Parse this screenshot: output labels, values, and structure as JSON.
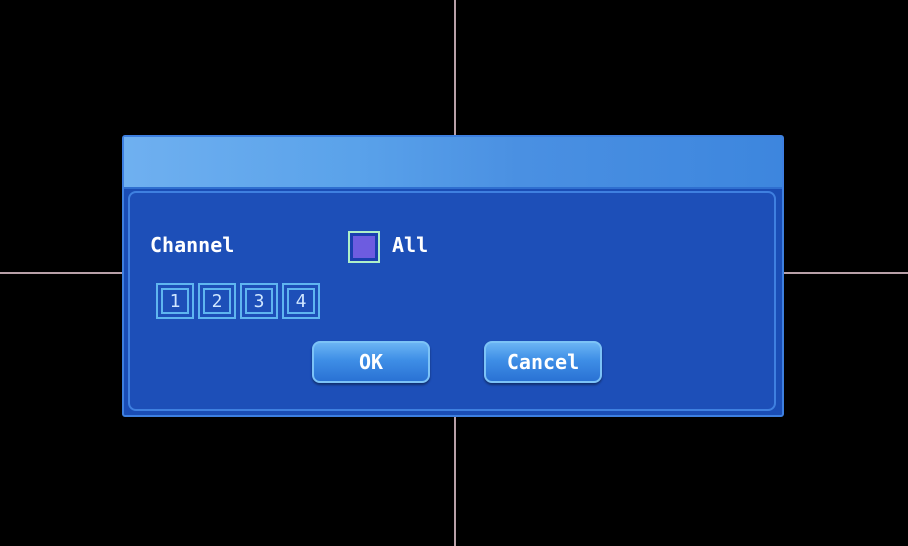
{
  "dialog": {
    "channel_label": "Channel",
    "all_label": "All",
    "channels": [
      "1",
      "2",
      "3",
      "4"
    ],
    "ok_label": "OK",
    "cancel_label": "Cancel"
  },
  "colors": {
    "dialog_background": "#1a4db5",
    "titlebar": "#5aa2ea",
    "button": "#3e8ee6",
    "checkbox_fill": "#6d5ce0",
    "checkbox_border": "#aef0c8",
    "channel_box_border": "#5fb6f0",
    "crosshair": "#b8a0a8"
  }
}
